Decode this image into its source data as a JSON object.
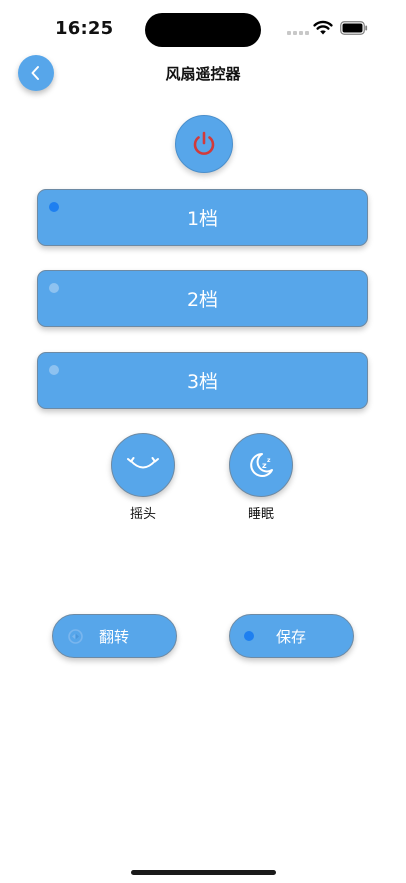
{
  "status_bar": {
    "time": "16:25"
  },
  "header": {
    "title": "风扇遥控器",
    "back_icon": "chevron-left-icon"
  },
  "power": {
    "icon": "power-icon",
    "icon_color": "#d23a3a"
  },
  "speeds": [
    {
      "label": "1档",
      "indicator_color": "#1e7ff0",
      "selected": true
    },
    {
      "label": "2档",
      "indicator_color": "#8ec2f0",
      "selected": false
    },
    {
      "label": "3档",
      "indicator_color": "#8ec2f0",
      "selected": false
    }
  ],
  "functions": {
    "swing": {
      "label": "摇头",
      "icon": "swing-icon"
    },
    "sleep": {
      "label": "睡眠",
      "icon": "moon-sleep-icon"
    }
  },
  "actions": {
    "flip": {
      "label": "翻转",
      "icon": "flip-icon"
    },
    "save": {
      "label": "保存",
      "dot_color": "#1e7ff0"
    }
  },
  "colors": {
    "accent": "#57a6ea",
    "border": "#6d8aa4",
    "text_on_accent": "#ffffff"
  }
}
